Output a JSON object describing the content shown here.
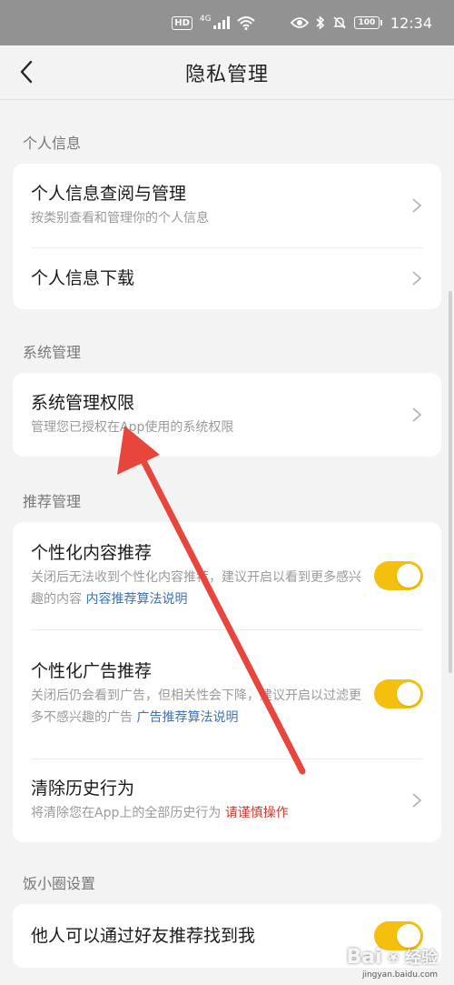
{
  "status_bar": {
    "hd_label": "HD",
    "network_label": "4G",
    "battery_level": "100",
    "time": "12:34"
  },
  "nav": {
    "title": "隐私管理"
  },
  "sections": [
    {
      "title": "个人信息",
      "rows": [
        {
          "title": "个人信息查阅与管理",
          "desc": "按类别查看和管理你的个人信息",
          "control": "chevron"
        },
        {
          "title": "个人信息下载",
          "control": "chevron"
        }
      ]
    },
    {
      "title": "系统管理",
      "rows": [
        {
          "title": "系统管理权限",
          "desc": "管理您已授权在App使用的系统权限",
          "control": "chevron"
        }
      ]
    },
    {
      "title": "推荐管理",
      "rows": [
        {
          "title": "个性化内容推荐",
          "desc": "关闭后无法收到个性化内容推荐，建议开启以看到更多感兴趣的内容",
          "link": "内容推荐算法说明",
          "control": "toggle",
          "on": true
        },
        {
          "title": "个性化广告推荐",
          "desc": "关闭后仍会看到广告，但相关性会下降，建议开启以过滤更多不感兴趣的广告",
          "link": "广告推荐算法说明",
          "control": "toggle",
          "on": true
        },
        {
          "title": "清除历史行为",
          "desc": "将清除您在App上的全部历史行为",
          "warn": "请谨慎操作",
          "control": "chevron"
        }
      ]
    },
    {
      "title": "饭小圈设置",
      "rows": [
        {
          "title": "他人可以通过好友推荐找到我",
          "control": "toggle",
          "on": true
        }
      ]
    }
  ],
  "colors": {
    "toggle_on": "#f5c00d",
    "link": "#3a73b8",
    "warning": "#c9392f",
    "arrow": "#e8453c"
  },
  "watermark": {
    "brand": "Bai",
    "suffix": "经验",
    "sub": "jingyan.baidu.com"
  }
}
